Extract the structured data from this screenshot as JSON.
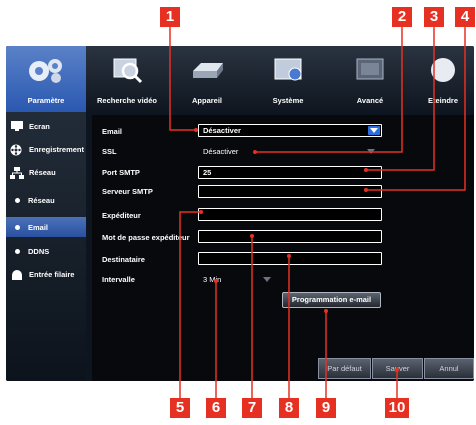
{
  "tabs": [
    {
      "label": "Paramètre",
      "icon": "gears-icon",
      "active": true
    },
    {
      "label": "Recherche vidéo",
      "icon": "video-search-icon",
      "active": false
    },
    {
      "label": "Appareil",
      "icon": "hard-disk-icon",
      "active": false
    },
    {
      "label": "Système",
      "icon": "system-info-icon",
      "active": false
    },
    {
      "label": "Avancé",
      "icon": "advanced-icon",
      "active": false
    },
    {
      "label": "Eteindre",
      "icon": "power-icon",
      "active": false
    }
  ],
  "sidebar": {
    "items": [
      {
        "label": "Ecran",
        "icon": "monitor-icon"
      },
      {
        "label": "Enregistrement",
        "icon": "film-reel-icon"
      },
      {
        "label": "Réseau",
        "icon": "network-icon"
      },
      {
        "label": "Réseau",
        "icon": "dot"
      },
      {
        "label": "Email",
        "icon": "dot",
        "active": true
      },
      {
        "label": "DDNS",
        "icon": "dot"
      },
      {
        "label": "Entrée filaire",
        "icon": "alarm-icon"
      }
    ]
  },
  "form": {
    "email": {
      "label": "Email",
      "value": "Désactiver"
    },
    "ssl": {
      "label": "SSL",
      "value": "Désactiver"
    },
    "port": {
      "label": "Port SMTP",
      "value": "25"
    },
    "server": {
      "label": "Serveur SMTP",
      "value": ""
    },
    "sender": {
      "label": "Expéditeur",
      "value": ""
    },
    "password": {
      "label": "Mot de passe expéditeur",
      "value": ""
    },
    "recipient": {
      "label": "Destinataire",
      "value": ""
    },
    "interval": {
      "label": "Intervalle",
      "value": "3 Min"
    },
    "schedule_button": "Programmation e-mail"
  },
  "buttons": {
    "default": "Par défaut",
    "save": "Sauver",
    "cancel": "Annul"
  },
  "callouts": [
    "1",
    "2",
    "3",
    "4",
    "5",
    "6",
    "7",
    "8",
    "9",
    "10"
  ],
  "colors": {
    "callout": "#e63022",
    "active_tab": "#3a68bc",
    "dropdown_button": "#2a6ee0"
  }
}
